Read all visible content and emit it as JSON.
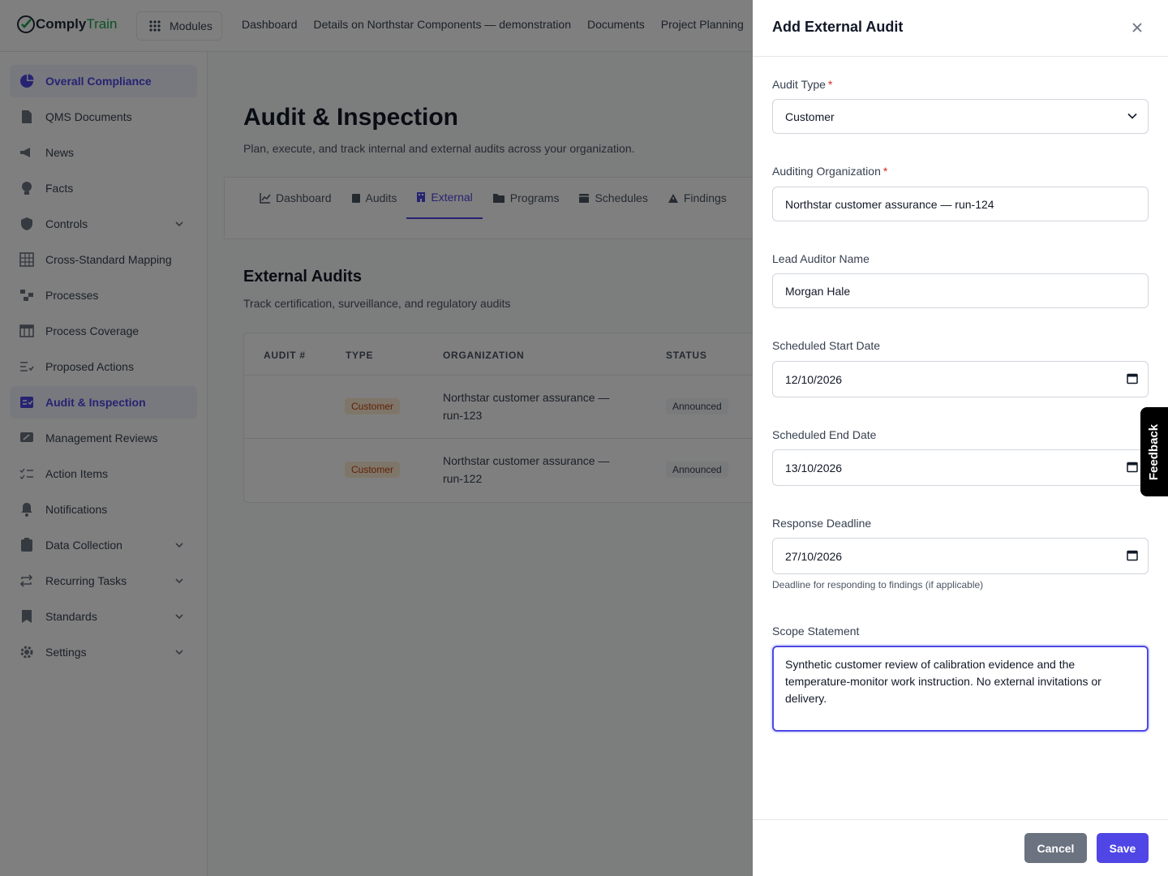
{
  "app": {
    "brand_part1": "Comply",
    "brand_part2": "Train",
    "modules_label": "Modules"
  },
  "topnav": [
    "Dashboard",
    "Details on Northstar Components — demonstration",
    "Documents",
    "Project Planning"
  ],
  "sidebar": {
    "items": [
      {
        "label": "Overall Compliance",
        "icon": "pie-chart-icon",
        "active": true
      },
      {
        "label": "QMS Documents",
        "icon": "document-icon"
      },
      {
        "label": "News",
        "icon": "megaphone-icon"
      },
      {
        "label": "Facts",
        "icon": "lightbulb-icon"
      },
      {
        "label": "Controls",
        "icon": "shield-icon",
        "expandable": true
      },
      {
        "label": "Cross-Standard Mapping",
        "icon": "grid-icon"
      },
      {
        "label": "Processes",
        "icon": "process-icon"
      },
      {
        "label": "Process Coverage",
        "icon": "table-icon"
      },
      {
        "label": "Proposed Actions",
        "icon": "list-check-icon"
      },
      {
        "label": "Audit & Inspection",
        "icon": "audit-icon",
        "active": true
      },
      {
        "label": "Management Reviews",
        "icon": "review-icon"
      },
      {
        "label": "Action Items",
        "icon": "checklist-icon"
      },
      {
        "label": "Notifications",
        "icon": "bell-icon"
      },
      {
        "label": "Data Collection",
        "icon": "clipboard-icon",
        "expandable": true
      },
      {
        "label": "Recurring Tasks",
        "icon": "repeat-icon",
        "expandable": true
      },
      {
        "label": "Standards",
        "icon": "bookmark-icon",
        "expandable": true
      },
      {
        "label": "Settings",
        "icon": "gear-icon",
        "expandable": true
      }
    ]
  },
  "main": {
    "title": "Audit & Inspection",
    "subtitle": "Plan, execute, and track internal and external audits across your organization.",
    "tabs": [
      {
        "label": "Dashboard",
        "icon": "chart-line-icon"
      },
      {
        "label": "Audits",
        "icon": "clipboard-check-icon"
      },
      {
        "label": "External",
        "icon": "building-icon",
        "active": true
      },
      {
        "label": "Programs",
        "icon": "folder-icon"
      },
      {
        "label": "Schedules",
        "icon": "calendar-icon"
      },
      {
        "label": "Findings",
        "icon": "warning-icon"
      }
    ],
    "section_title": "External Audits",
    "section_subtitle": "Track certification, surveillance, and regulatory audits",
    "table": {
      "columns": [
        "AUDIT #",
        "TYPE",
        "ORGANIZATION",
        "STATUS"
      ],
      "rows": [
        {
          "audit": "",
          "type": "Customer",
          "organization": "Northstar customer assurance — run-123",
          "status": "Announced"
        },
        {
          "audit": "",
          "type": "Customer",
          "organization": "Northstar customer assurance — run-122",
          "status": "Announced"
        }
      ]
    }
  },
  "drawer": {
    "title": "Add External Audit",
    "audit_type_label": "Audit Type",
    "audit_type_value": "Customer",
    "org_label": "Auditing Organization",
    "org_value": "Northstar customer assurance — run-124",
    "lead_label": "Lead Auditor Name",
    "lead_value": "Morgan Hale",
    "start_label": "Scheduled Start Date",
    "start_value": "12/10/2026",
    "end_label": "Scheduled End Date",
    "end_value": "13/10/2026",
    "deadline_label": "Response Deadline",
    "deadline_value": "27/10/2026",
    "deadline_hint": "Deadline for responding to findings (if applicable)",
    "scope_label": "Scope Statement",
    "scope_value": "Synthetic customer review of calibration evidence and the temperature-monitor work instruction. No external invitations or delivery.",
    "cancel": "Cancel",
    "save": "Save",
    "required_mark": "*"
  },
  "feedback_label": "Feedback",
  "colors": {
    "accent": "#4f46e5",
    "overlay": "rgba(0,0,0,0.5)",
    "badge_bg": "#ffedd5",
    "badge_text": "#c2410c",
    "required": "#dc2626"
  }
}
